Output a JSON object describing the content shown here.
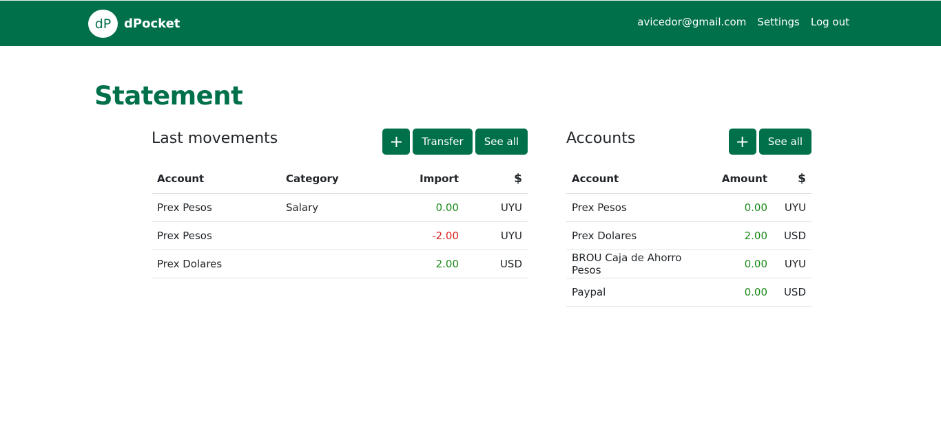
{
  "navbar": {
    "logo_text": "dP",
    "brand": "dPocket",
    "links": [
      "avicedor@gmail.com",
      "Settings",
      "Log out"
    ],
    "color": "#00704a"
  },
  "page": {
    "title": "Statement"
  },
  "movements": {
    "title": "Last movements",
    "buttons": {
      "add": "+",
      "transfer": "Transfer",
      "see_all": "See all"
    },
    "headers": [
      "Account",
      "Category",
      "Import",
      "$"
    ],
    "rows": [
      {
        "account": "Prex Pesos",
        "category": "Salary",
        "import": "0.00",
        "currency": "UYU",
        "sign": "pos"
      },
      {
        "account": "Prex Pesos",
        "category": "",
        "import": "-2.00",
        "currency": "UYU",
        "sign": "neg"
      },
      {
        "account": "Prex Dolares",
        "category": "",
        "import": "2.00",
        "currency": "USD",
        "sign": "pos"
      }
    ]
  },
  "accounts": {
    "title": "Accounts",
    "buttons": {
      "add": "+",
      "see_all": "See all"
    },
    "headers": [
      "Account",
      "Amount",
      "$"
    ],
    "rows": [
      {
        "account": "Prex Pesos",
        "amount": "0.00",
        "currency": "UYU"
      },
      {
        "account": "Prex Dolares",
        "amount": "2.00",
        "currency": "USD"
      },
      {
        "account": "BROU Caja de Ahorro Pesos",
        "amount": "0.00",
        "currency": "UYU"
      },
      {
        "account": "Paypal",
        "amount": "0.00",
        "currency": "USD"
      }
    ]
  }
}
